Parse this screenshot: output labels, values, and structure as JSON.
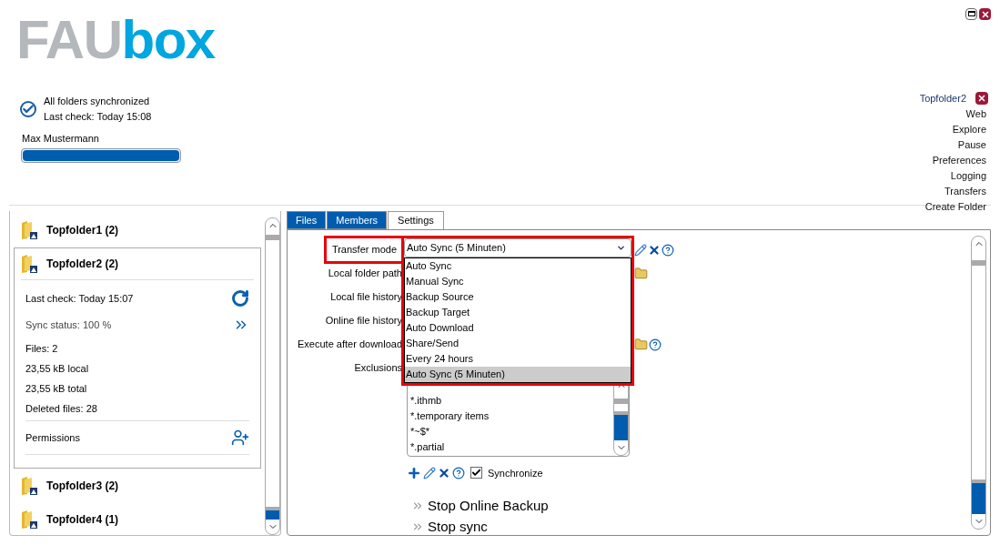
{
  "logo": {
    "parts": [
      "FAU",
      "box"
    ]
  },
  "status": {
    "synced": true,
    "lines": [
      "All folders synchronized",
      "Last check: Today 15:08"
    ]
  },
  "user": {
    "name": "Max Mustermann",
    "quota": {
      "level": 1
    }
  },
  "folder_actions": {
    "folder": "Topfolder2",
    "items": [
      "Web",
      "Explore",
      "Pause",
      "Preferences",
      "Logging",
      "Transfers",
      "Create Folder"
    ]
  },
  "folders": [
    {
      "name": "Topfolder1 (2)",
      "expanded": false
    },
    {
      "name": "Topfolder2 (2)",
      "expanded": true,
      "details": [
        {
          "text": "Last check: Today 15:07",
          "kind": "refresh"
        },
        {
          "text": "Sync status: 100 %",
          "kind": "more"
        },
        {
          "text": "Files: 2",
          "kind": "plain"
        },
        {
          "text": "23,55 kB local",
          "kind": "plain"
        },
        {
          "text": "23,55 kB total",
          "kind": "plain"
        },
        {
          "text": "Deleted files: 28",
          "kind": "plain"
        }
      ],
      "permissions": "Permissions"
    },
    {
      "name": "Topfolder3 (2)",
      "expanded": false
    },
    {
      "name": "Topfolder4 (1)",
      "expanded": false
    }
  ],
  "tabs": [
    {
      "label": "Files",
      "selected": false
    },
    {
      "label": "Members",
      "selected": false
    },
    {
      "label": "Settings",
      "selected": true
    }
  ],
  "settings": {
    "rows": [
      {
        "label": "Transfer mode",
        "highlighted": true,
        "icons": [
          {
            "kind": "edit"
          },
          {
            "kind": "delete"
          },
          {
            "kind": "help"
          }
        ]
      },
      {
        "label": "Local folder path",
        "highlighted": false,
        "icons": [
          {
            "kind": "folder"
          }
        ]
      },
      {
        "label": "Local file history",
        "highlighted": false
      },
      {
        "label": "Online file history",
        "highlighted": false
      },
      {
        "label": "Execute after download",
        "highlighted": false,
        "icons": [
          {
            "kind": "folder"
          },
          {
            "kind": "help"
          }
        ]
      },
      {
        "label": "Exclusions",
        "highlighted": false
      }
    ],
    "transfer_mode": {
      "value": "Auto Sync (5 Minuten)",
      "expanded": true,
      "highlighted": true,
      "options": [
        {
          "label": "Auto Sync",
          "selected": false
        },
        {
          "label": "Manual Sync",
          "selected": false
        },
        {
          "label": "Backup Source",
          "selected": false
        },
        {
          "label": "Backup Target",
          "selected": false
        },
        {
          "label": "Auto Download",
          "selected": false
        },
        {
          "label": "Share/Send",
          "selected": false
        },
        {
          "label": "Every 24 hours",
          "selected": false
        },
        {
          "label": "Auto Sync (5 Minuten)",
          "selected": true
        }
      ]
    },
    "exclusions": [
      "*.ithmb",
      "*.temporary items",
      "*~$*",
      "*.partial"
    ],
    "exclusion_tools": [
      {
        "kind": "add"
      },
      {
        "kind": "edit"
      },
      {
        "kind": "delete"
      },
      {
        "kind": "help"
      }
    ],
    "synchronize": {
      "label": "Synchronize",
      "checked": true
    },
    "actions": [
      "Stop Online Backup",
      "Stop sync"
    ]
  }
}
